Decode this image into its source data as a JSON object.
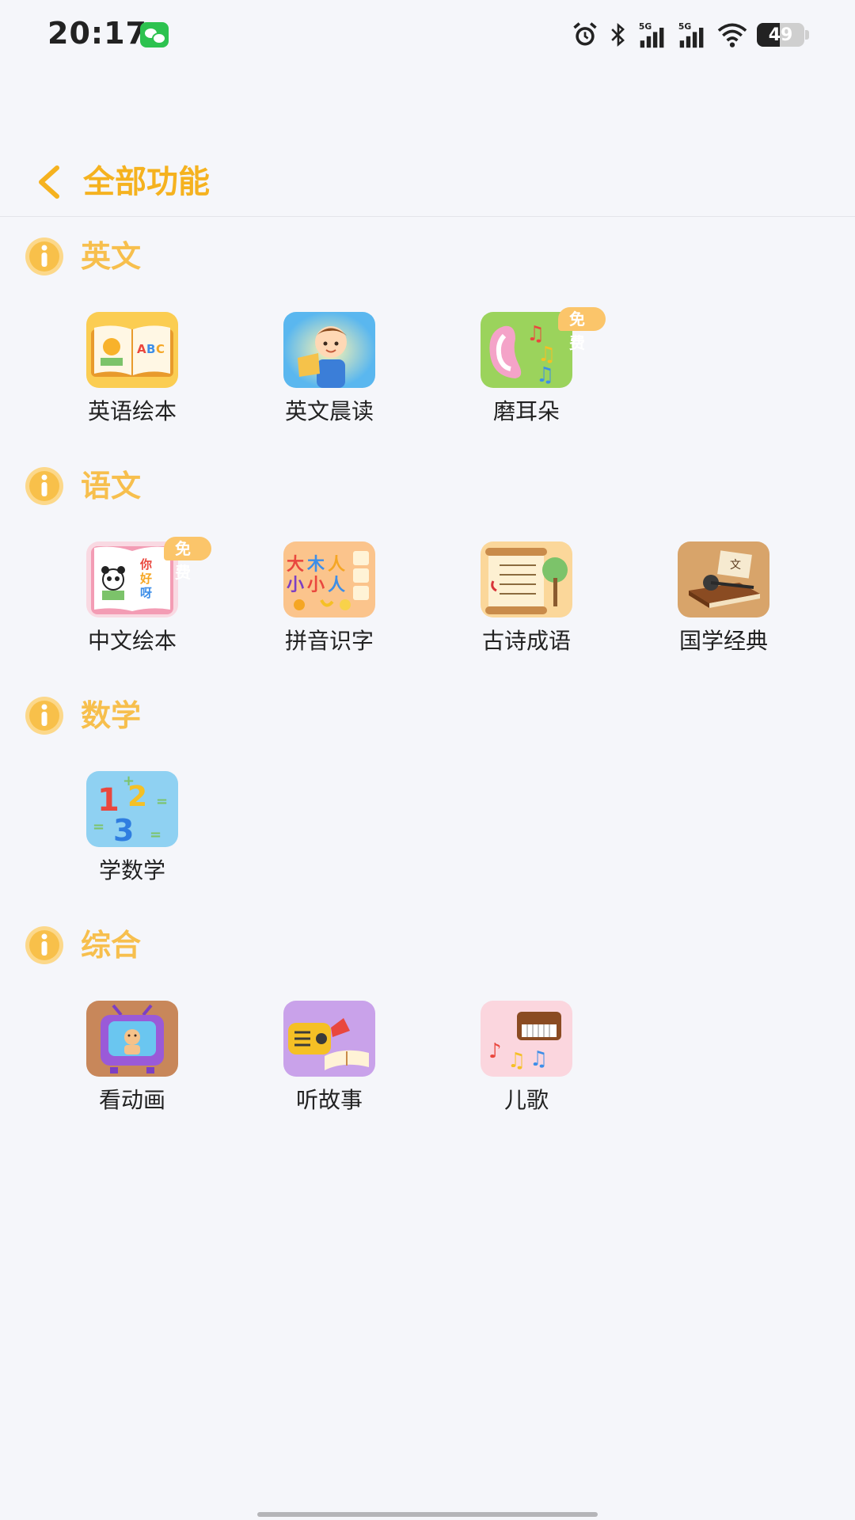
{
  "status_bar": {
    "time": "20:17",
    "battery_level": "49",
    "icons": [
      "wechat-icon",
      "alarm-icon",
      "bluetooth-icon",
      "signal-5g-icon",
      "signal-5g-icon",
      "wifi-icon",
      "battery-icon"
    ]
  },
  "header": {
    "back_icon": "chevron-left-icon",
    "title": "全部功能"
  },
  "colors": {
    "accent": "#f5b21f",
    "section_title": "#f7bf4d",
    "badge": "#fbc56a",
    "background": "#f5f6fa"
  },
  "sections": [
    {
      "title": "英文",
      "icon": "info-icon",
      "items": [
        {
          "label": "英语绘本",
          "icon": "picture-book-abc-icon",
          "badge": ""
        },
        {
          "label": "英文晨读",
          "icon": "boy-reading-icon",
          "badge": ""
        },
        {
          "label": "磨耳朵",
          "icon": "ear-music-notes-icon",
          "badge": "免费"
        }
      ]
    },
    {
      "title": "语文",
      "icon": "info-icon",
      "items": [
        {
          "label": "中文绘本",
          "icon": "panda-book-icon",
          "badge": "免费"
        },
        {
          "label": "拼音识字",
          "icon": "chinese-characters-icon",
          "badge": ""
        },
        {
          "label": "古诗成语",
          "icon": "poetry-scroll-icon",
          "badge": ""
        },
        {
          "label": "国学经典",
          "icon": "classic-book-icon",
          "badge": ""
        }
      ]
    },
    {
      "title": "数学",
      "icon": "info-icon",
      "items": [
        {
          "label": "学数学",
          "icon": "numbers-123-icon",
          "badge": ""
        }
      ]
    },
    {
      "title": "综合",
      "icon": "info-icon",
      "items": [
        {
          "label": "看动画",
          "icon": "tv-cartoon-icon",
          "badge": ""
        },
        {
          "label": "听故事",
          "icon": "radio-story-icon",
          "badge": ""
        },
        {
          "label": "儿歌",
          "icon": "piano-music-icon",
          "badge": ""
        }
      ]
    }
  ]
}
